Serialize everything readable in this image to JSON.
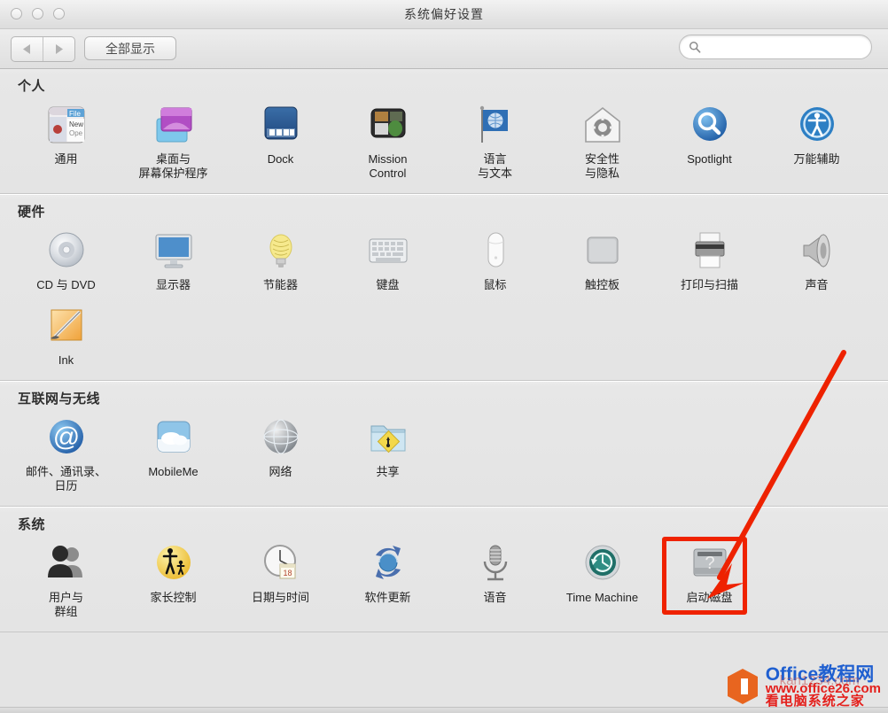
{
  "window": {
    "title": "系统偏好设置",
    "traffic_lights": [
      "close",
      "minimize",
      "zoom"
    ]
  },
  "toolbar": {
    "back_label": "◀",
    "forward_label": "▶",
    "show_all_label": "全部显示",
    "search_placeholder": "",
    "search_value": ""
  },
  "sections": [
    {
      "title": "个人",
      "items": [
        {
          "label": "通用",
          "icon": "general-icon"
        },
        {
          "label": "桌面与\n屏幕保护程序",
          "icon": "desktop-screensaver-icon"
        },
        {
          "label": "Dock",
          "icon": "dock-icon"
        },
        {
          "label": "Mission\nControl",
          "icon": "mission-control-icon"
        },
        {
          "label": "语言\n与文本",
          "icon": "language-text-icon"
        },
        {
          "label": "安全性\n与隐私",
          "icon": "security-privacy-icon"
        },
        {
          "label": "Spotlight",
          "icon": "spotlight-icon"
        },
        {
          "label": "万能辅助",
          "icon": "accessibility-icon"
        }
      ]
    },
    {
      "title": "硬件",
      "items": [
        {
          "label": "CD 与 DVD",
          "icon": "cd-dvd-icon"
        },
        {
          "label": "显示器",
          "icon": "displays-icon"
        },
        {
          "label": "节能器",
          "icon": "energy-saver-icon"
        },
        {
          "label": "键盘",
          "icon": "keyboard-icon"
        },
        {
          "label": "鼠标",
          "icon": "mouse-icon"
        },
        {
          "label": "触控板",
          "icon": "trackpad-icon"
        },
        {
          "label": "打印与扫描",
          "icon": "print-scan-icon"
        },
        {
          "label": "声音",
          "icon": "sound-icon"
        },
        {
          "label": "Ink",
          "icon": "ink-icon"
        }
      ]
    },
    {
      "title": "互联网与无线",
      "items": [
        {
          "label": "邮件、通讯录、\n日历",
          "icon": "mail-contacts-calendars-icon"
        },
        {
          "label": "MobileMe",
          "icon": "mobileme-icon"
        },
        {
          "label": "网络",
          "icon": "network-icon"
        },
        {
          "label": "共享",
          "icon": "sharing-icon"
        }
      ]
    },
    {
      "title": "系统",
      "items": [
        {
          "label": "用户与\n群组",
          "icon": "users-groups-icon"
        },
        {
          "label": "家长控制",
          "icon": "parental-controls-icon"
        },
        {
          "label": "日期与时间",
          "icon": "date-time-icon",
          "badge": "18"
        },
        {
          "label": "软件更新",
          "icon": "software-update-icon"
        },
        {
          "label": "语音",
          "icon": "speech-icon"
        },
        {
          "label": "Time Machine",
          "icon": "time-machine-icon"
        },
        {
          "label": "启动磁盘",
          "icon": "startup-disk-icon",
          "highlighted": true
        }
      ]
    }
  ],
  "annotation": {
    "arrow_color": "#ee2200",
    "highlight_color": "#ef2200",
    "target_label": "启动磁盘"
  },
  "watermark": {
    "brand": "Office教程网",
    "url": "www.office26.com",
    "subtitle": "看电脑系统之家",
    "ghost": "kan1234.com",
    "logo_color": "#e8651f"
  }
}
